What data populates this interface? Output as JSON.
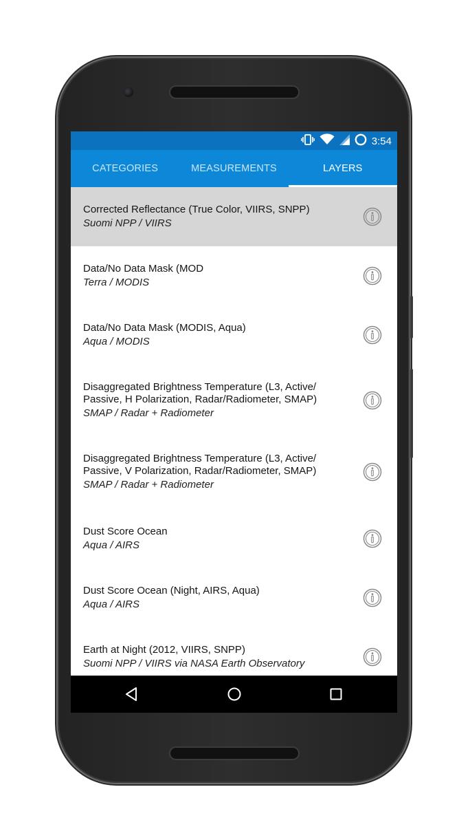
{
  "status_bar": {
    "time": "3:54",
    "icons": [
      "vibrate-icon",
      "wifi-icon",
      "signal-icon",
      "battery-icon"
    ]
  },
  "tabs": [
    {
      "label": "CATEGORIES",
      "active": false
    },
    {
      "label": "MEASUREMENTS",
      "active": false
    },
    {
      "label": "LAYERS",
      "active": true
    }
  ],
  "layers": [
    {
      "title": "Corrected Reflectance (True Color, VIIRS, SNPP)",
      "source": "Suomi NPP / VIIRS",
      "selected": true
    },
    {
      "title": "Data/No Data Mask (MOD",
      "source": "Terra / MODIS",
      "selected": false
    },
    {
      "title": "Data/No Data Mask (MODIS, Aqua)",
      "source": "Aqua / MODIS",
      "selected": false
    },
    {
      "title_lines": [
        "Disaggregated Brightness Temperature (L3, Active/",
        "Passive, H Polarization, Radar/Radiometer, SMAP)"
      ],
      "source": "SMAP / Radar + Radiometer",
      "selected": false
    },
    {
      "title_lines": [
        "Disaggregated Brightness Temperature (L3, Active/",
        "Passive, V Polarization, Radar/Radiometer, SMAP)"
      ],
      "source": "SMAP / Radar + Radiometer",
      "selected": false
    },
    {
      "title": "Dust Score Ocean",
      "source": "Aqua / AIRS",
      "selected": false
    },
    {
      "title": "Dust Score Ocean (Night, AIRS, Aqua)",
      "source": "Aqua / AIRS",
      "selected": false
    },
    {
      "title": "Earth at Night (2012, VIIRS, SNPP)",
      "source": "Suomi NPP / VIIRS via NASA Earth Observatory",
      "selected": false
    }
  ],
  "nav_bar": {
    "buttons": [
      "back-icon",
      "home-icon",
      "recents-icon"
    ]
  },
  "colors": {
    "status_bar": "#0a72be",
    "tab_bar": "#0d88d8",
    "selected_row": "#d6d6d6",
    "info_icon": "#8a8a8a"
  }
}
